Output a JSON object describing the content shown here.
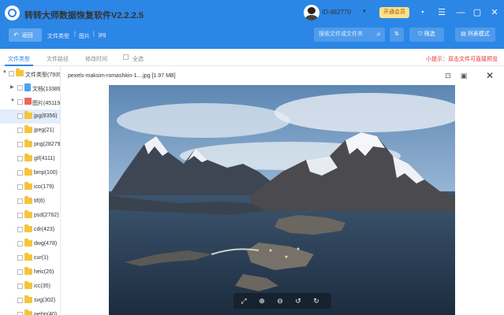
{
  "app": {
    "title": "转转大师数据恢复软件V2.2.2.5"
  },
  "user": {
    "id": "ID:482770",
    "vip_label": "开通会员"
  },
  "toolbar": {
    "back_label": "返回",
    "breadcrumb": [
      "文件类型",
      "图片",
      "jpg"
    ],
    "search_placeholder": "搜索文件或文件夹",
    "filter_label": "筛选",
    "list_mode_label": "列表模式"
  },
  "tabs": [
    "文件类型",
    "文件路径",
    "修改时间"
  ],
  "select_all_label": "全选",
  "tip": "小提示：双击文件可直接预览",
  "tree": {
    "root": "文件类型(79354)",
    "docs": "文档(13389)",
    "images": "图片(45119)",
    "types": [
      "jpg(8356)",
      "jpeg(21)",
      "png(28279)",
      "gif(4111)",
      "bmp(100)",
      "ico(179)",
      "tif(6)",
      "psd(2762)",
      "cdr(423)",
      "dwg(478)",
      "cur(1)",
      "heic(26)",
      "icc(35)",
      "svg(302)",
      "webp(40)"
    ]
  },
  "preview": {
    "title": "pexels-maksim-romashkin-1....jpg [1.97 MB]"
  }
}
